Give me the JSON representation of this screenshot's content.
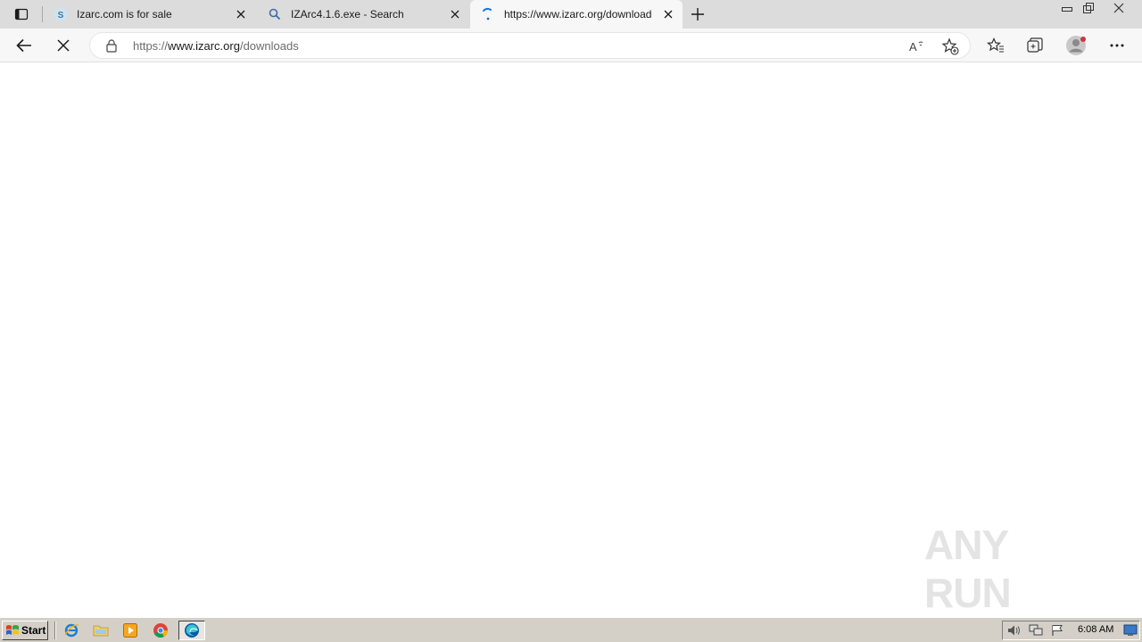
{
  "browser": {
    "tabs": [
      {
        "title": "Izarc.com is for sale",
        "favicon": "s-site-icon"
      },
      {
        "title": "IZArc4.1.6.exe - Search",
        "favicon": "search-icon"
      },
      {
        "title": "https://www.izarc.org/download",
        "favicon": "loading-spinner-icon",
        "active": true
      }
    ],
    "address": {
      "scheme": "https://",
      "host": "www.izarc.org",
      "path": "/downloads"
    }
  },
  "watermark": {
    "text": "ANY RUN"
  },
  "taskbar": {
    "start_label": "Start",
    "quick_launch": [
      "ie-icon",
      "folder-icon",
      "media-player-icon",
      "chrome-icon",
      "edge-icon"
    ],
    "clock": "6:08 AM"
  },
  "colors": {
    "tabstrip": "#dcdcdc",
    "toolbar": "#f7f7f7",
    "taskbar": "#d4d0c8",
    "watermark": "#e4e4e4"
  }
}
